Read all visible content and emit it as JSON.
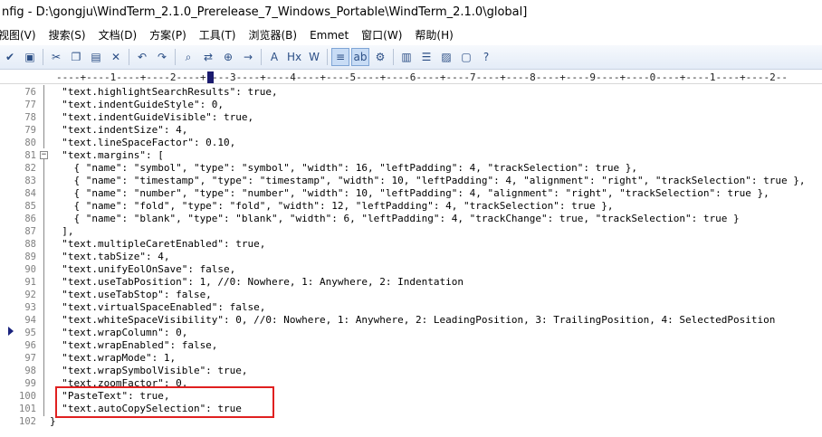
{
  "title": "nfig - D:\\gongju\\WindTerm_2.1.0_Prerelease_7_Windows_Portable\\WindTerm_2.1.0\\global]",
  "menu": [
    "视图(V)",
    "搜索(S)",
    "文档(D)",
    "方案(P)",
    "工具(T)",
    "浏览器(B)",
    "Emmet",
    "窗口(W)",
    "帮助(H)"
  ],
  "toolbar": [
    {
      "icon": "spellcheck-icon",
      "glyph": "✔",
      "active": false
    },
    {
      "icon": "browser-preview-icon",
      "glyph": "▣",
      "active": false
    },
    {
      "icon": "cut-icon",
      "glyph": "✂",
      "active": false
    },
    {
      "icon": "copy-icon",
      "glyph": "❐",
      "active": false
    },
    {
      "icon": "paste-icon",
      "glyph": "▤",
      "active": false
    },
    {
      "icon": "delete-icon",
      "glyph": "✕",
      "active": false
    },
    {
      "icon": "undo-icon",
      "glyph": "↶",
      "active": false
    },
    {
      "icon": "redo-icon",
      "glyph": "↷",
      "active": false
    },
    {
      "icon": "find-icon",
      "glyph": "⌕",
      "active": false
    },
    {
      "icon": "replace-icon",
      "glyph": "⇄",
      "active": false
    },
    {
      "icon": "find-in-files-icon",
      "glyph": "⊕",
      "active": false
    },
    {
      "icon": "goto-line-icon",
      "glyph": "→",
      "active": false
    },
    {
      "icon": "font-icon",
      "glyph": "A",
      "active": false
    },
    {
      "icon": "header-icon",
      "glyph": "Hx",
      "active": false
    },
    {
      "icon": "word-wrap-icon",
      "glyph": "W",
      "active": false
    },
    {
      "icon": "line-numbers-icon",
      "glyph": "≡",
      "active": true
    },
    {
      "icon": "abc-icon",
      "glyph": "ab",
      "active": true
    },
    {
      "icon": "settings-icon",
      "glyph": "⚙",
      "active": false
    },
    {
      "icon": "panel-icon",
      "glyph": "▥",
      "active": false
    },
    {
      "icon": "list-icon",
      "glyph": "☰",
      "active": false
    },
    {
      "icon": "image-icon",
      "glyph": "▨",
      "active": false
    },
    {
      "icon": "window-icon",
      "glyph": "▢",
      "active": false
    },
    {
      "icon": "help-cursor-icon",
      "glyph": "?",
      "active": false
    }
  ],
  "ruler": "----+----1----+----2----+----3----+----4----+----5----+----6----+----7----+----8----+----9----+----0----+----1----+----2--",
  "lines": [
    {
      "n": "76",
      "code": "  \"text.highlightSearchResults\": true,"
    },
    {
      "n": "77",
      "code": "  \"text.indentGuideStyle\": 0,"
    },
    {
      "n": "78",
      "code": "  \"text.indentGuideVisible\": true,"
    },
    {
      "n": "79",
      "code": "  \"text.indentSize\": 4,"
    },
    {
      "n": "80",
      "code": "  \"text.lineSpaceFactor\": 0.10,"
    },
    {
      "n": "81",
      "code": "  \"text.margins\": ["
    },
    {
      "n": "82",
      "code": "    { \"name\": \"symbol\", \"type\": \"symbol\", \"width\": 16, \"leftPadding\": 4, \"trackSelection\": true },"
    },
    {
      "n": "83",
      "code": "    { \"name\": \"timestamp\", \"type\": \"timestamp\", \"width\": 10, \"leftPadding\": 4, \"alignment\": \"right\", \"trackSelection\": true },"
    },
    {
      "n": "84",
      "code": "    { \"name\": \"number\", \"type\": \"number\", \"width\": 10, \"leftPadding\": 4, \"alignment\": \"right\", \"trackSelection\": true },"
    },
    {
      "n": "85",
      "code": "    { \"name\": \"fold\", \"type\": \"fold\", \"width\": 12, \"leftPadding\": 4, \"trackSelection\": true },"
    },
    {
      "n": "86",
      "code": "    { \"name\": \"blank\", \"type\": \"blank\", \"width\": 6, \"leftPadding\": 4, \"trackChange\": true, \"trackSelection\": true }"
    },
    {
      "n": "87",
      "code": "  ],"
    },
    {
      "n": "88",
      "code": "  \"text.multipleCaretEnabled\": true,"
    },
    {
      "n": "89",
      "code": "  \"text.tabSize\": 4,"
    },
    {
      "n": "90",
      "code": "  \"text.unifyEolOnSave\": false,"
    },
    {
      "n": "91",
      "code": "  \"text.useTabPosition\": 1, //0: Nowhere, 1: Anywhere, 2: Indentation"
    },
    {
      "n": "92",
      "code": "  \"text.useTabStop\": false,"
    },
    {
      "n": "93",
      "code": "  \"text.virtualSpaceEnabled\": false,"
    },
    {
      "n": "94",
      "code": "  \"text.whiteSpaceVisibility\": 0, //0: Nowhere, 1: Anywhere, 2: LeadingPosition, 3: TrailingPosition, 4: SelectedPosition"
    },
    {
      "n": "95",
      "code": "  \"text.wrapColumn\": 0,"
    },
    {
      "n": "96",
      "code": "  \"text.wrapEnabled\": false,"
    },
    {
      "n": "97",
      "code": "  \"text.wrapMode\": 1,"
    },
    {
      "n": "98",
      "code": "  \"text.wrapSymbolVisible\": true,"
    },
    {
      "n": "99",
      "code": "  \"text.zoomFactor\": 0,"
    },
    {
      "n": "100",
      "code": "  \"PasteText\": true,"
    },
    {
      "n": "101",
      "code": "  \"text.autoCopySelection\": true"
    },
    {
      "n": "102",
      "code": "}"
    }
  ],
  "fold_marker": "⊟"
}
